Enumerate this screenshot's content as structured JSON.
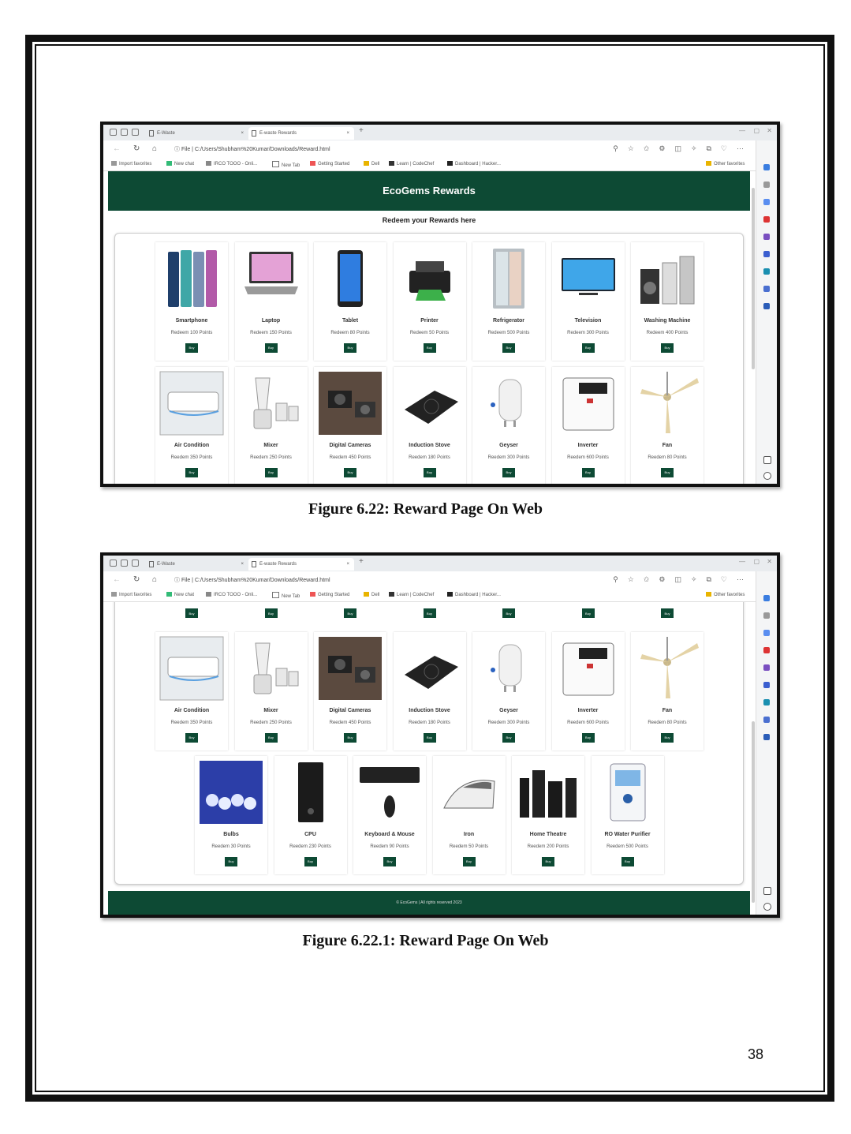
{
  "browser": {
    "tab_inactive": "E-Waste",
    "tab_active": "E-waste Rewards",
    "url": "C:/Users/Shubham%20Kumar/Downloads/Reward.html",
    "url_prefix": "File",
    "favorites": [
      "Import favorites",
      "New chat",
      "IRCO TOOO - Onli...",
      "New Tab",
      "Getting Started",
      "Dell",
      "Learn | CodeChef",
      "Dashboard | Hacker..."
    ],
    "other_favorites": "Other favorites"
  },
  "site": {
    "title": "EcoGems Rewards",
    "subtitle": "Redeem your Rewards here",
    "buy_label": "Buy",
    "footer": "© EcoGems | All rights reserved 2023"
  },
  "row1": [
    {
      "name": "Smartphone",
      "points": "Redeem 100 Points",
      "icon": "smartphone-icon"
    },
    {
      "name": "Laptop",
      "points": "Redeem 150 Points",
      "icon": "laptop-icon"
    },
    {
      "name": "Tablet",
      "points": "Redeem 80 Points",
      "icon": "tablet-icon"
    },
    {
      "name": "Printer",
      "points": "Redeem 50 Points",
      "icon": "printer-icon"
    },
    {
      "name": "Refrigerator",
      "points": "Redeem 500 Points",
      "icon": "refrigerator-icon"
    },
    {
      "name": "Television",
      "points": "Redeem 300 Points",
      "icon": "television-icon"
    },
    {
      "name": "Washing Machine",
      "points": "Redeem 400 Points",
      "icon": "washing-machine-icon"
    }
  ],
  "row2": [
    {
      "name": "Air Condition",
      "points": "Reedem 350 Points",
      "icon": "air-conditioner-icon"
    },
    {
      "name": "Mixer",
      "points": "Reedem 250 Points",
      "icon": "mixer-icon"
    },
    {
      "name": "Digital Cameras",
      "points": "Reedem 450 Points",
      "icon": "camera-icon"
    },
    {
      "name": "Induction Stove",
      "points": "Reedem 180 Points",
      "icon": "induction-stove-icon"
    },
    {
      "name": "Geyser",
      "points": "Reedem 300 Points",
      "icon": "geyser-icon"
    },
    {
      "name": "Inverter",
      "points": "Reedem 600 Points",
      "icon": "inverter-icon"
    },
    {
      "name": "Fan",
      "points": "Reedem 80 Points",
      "icon": "fan-icon"
    }
  ],
  "row3": [
    {
      "name": "Bulbs",
      "points": "Reedem 30 Points",
      "icon": "bulbs-icon"
    },
    {
      "name": "CPU",
      "points": "Reedem 230 Points",
      "icon": "cpu-icon"
    },
    {
      "name": "Keyboard & Mouse",
      "points": "Reedem 90 Points",
      "icon": "keyboard-icon"
    },
    {
      "name": "Iron",
      "points": "Reedem 50 Points",
      "icon": "iron-icon"
    },
    {
      "name": "Home Theatre",
      "points": "Reedem 200 Points",
      "icon": "home-theatre-icon"
    },
    {
      "name": "RO Water Purifier",
      "points": "Reedem 500 Points",
      "icon": "water-purifier-icon"
    }
  ],
  "captions": {
    "figure1": "Figure 6.22: Reward Page On Web",
    "figure2": "Figure 6.22.1: Reward Page On Web"
  },
  "page_number": "38"
}
